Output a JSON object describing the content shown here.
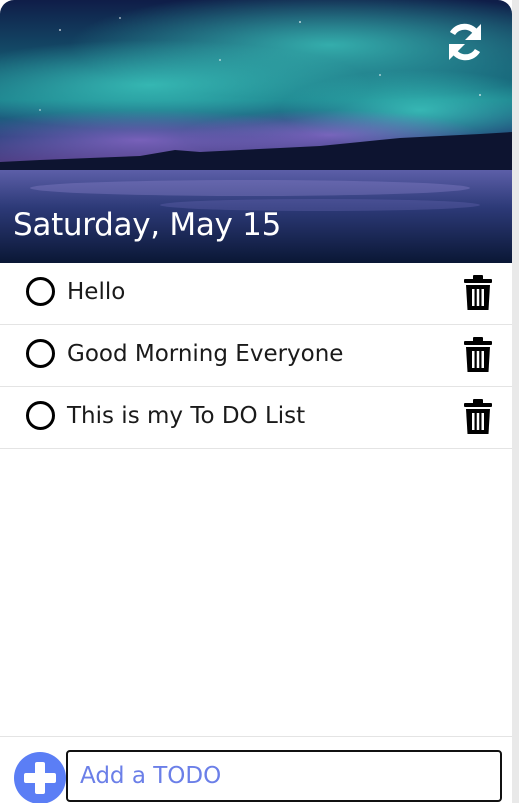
{
  "header": {
    "date": "Saturday, May 15",
    "refresh_icon": "refresh-icon"
  },
  "todos": [
    {
      "text": "Hello",
      "done": false
    },
    {
      "text": "Good Morning Everyone",
      "done": false
    },
    {
      "text": "This is my To DO List",
      "done": false
    }
  ],
  "icons": {
    "check": "circle-outline-icon",
    "delete": "trash-icon",
    "add": "plus-circle-icon"
  },
  "footer": {
    "input_placeholder": "Add a TODO"
  },
  "colors": {
    "accent": "#5b7ef5",
    "placeholder": "#6b7fe8",
    "divider": "#e4e4e4"
  }
}
